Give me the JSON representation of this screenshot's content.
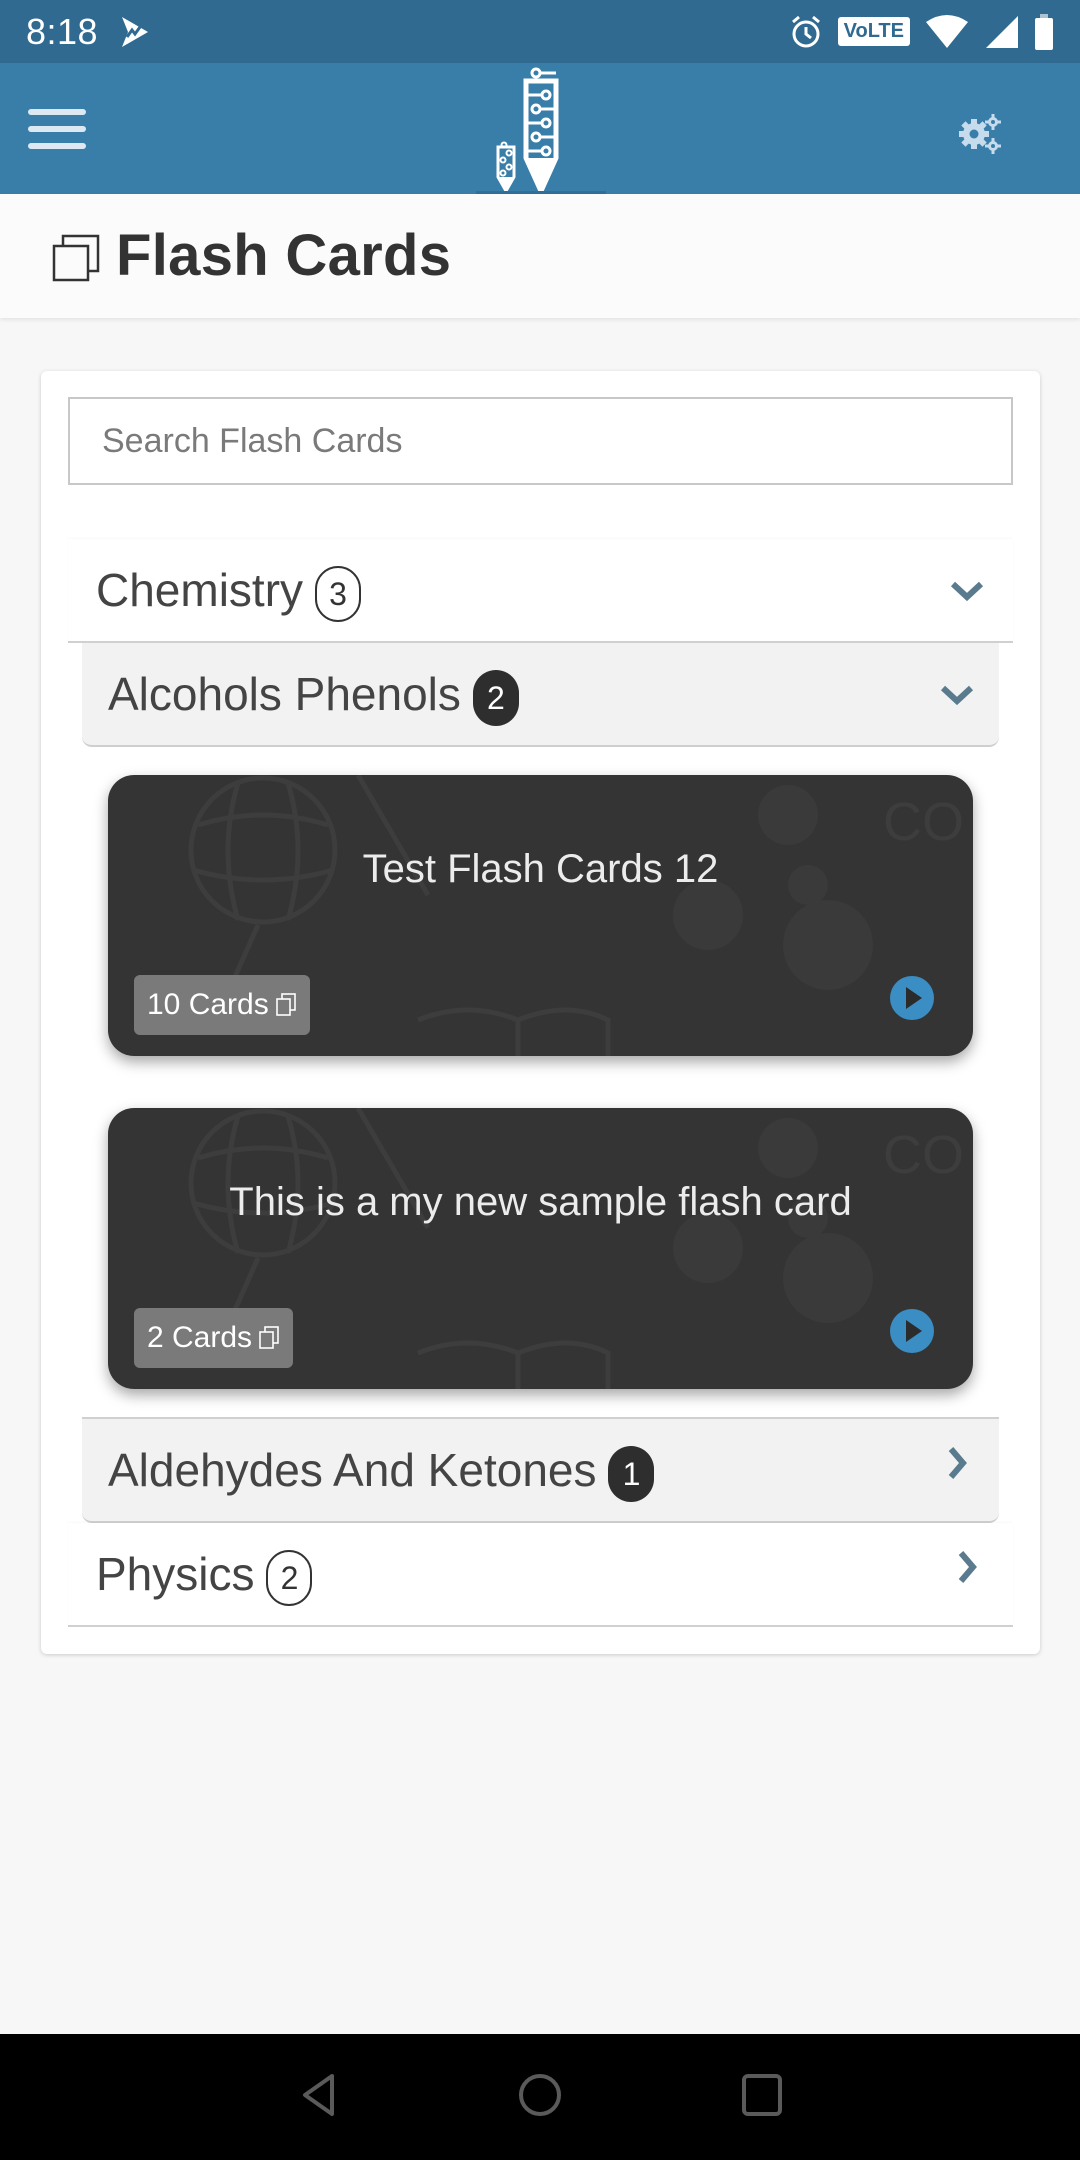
{
  "status_bar": {
    "time": "8:18",
    "network_badge": "VoLTE",
    "icons": [
      "app-notification-icon",
      "alarm-icon",
      "volte-icon",
      "wifi-icon",
      "signal-icon",
      "battery-icon"
    ]
  },
  "app_bar": {
    "menu_icon": "hamburger-menu-icon",
    "logo": "circuit-pencils-logo",
    "settings_icon": "gears-icon",
    "colors": {
      "status_bar": "#306a91",
      "app_bar": "#387ea9"
    }
  },
  "page": {
    "title": "Flash Cards",
    "title_icon": "copy-cards-icon"
  },
  "search": {
    "placeholder": "Search Flash Cards",
    "value": ""
  },
  "subjects": [
    {
      "name": "Chemistry",
      "count": "3",
      "expanded": true,
      "chapters": [
        {
          "name": "Alcohols Phenols",
          "count": "2",
          "expanded": true,
          "decks": [
            {
              "title": "Test Flash Cards 12",
              "cards_label": "10 Cards"
            },
            {
              "title": "This is a my new sample flash card",
              "cards_label": "2 Cards"
            }
          ]
        },
        {
          "name": "Aldehydes And Ketones",
          "count": "1",
          "expanded": false
        }
      ]
    },
    {
      "name": "Physics",
      "count": "2",
      "expanded": false
    }
  ],
  "colors": {
    "accent_play": "#3b8ec4",
    "chevron": "#5a7b8e",
    "card_bg": "#343434",
    "count_chip": "#7a7a7a"
  },
  "nav_bar": {
    "buttons": [
      "back",
      "home",
      "recents"
    ]
  }
}
